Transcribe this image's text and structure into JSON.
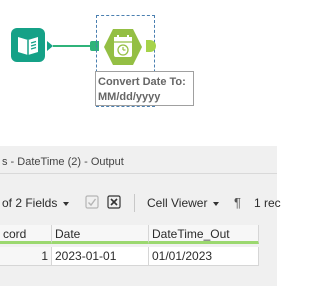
{
  "canvas": {
    "annotation": "Convert Date To:\nMM/dd/yyyy",
    "colors": {
      "input_tool": "#15a187",
      "connection": "#2fb37a",
      "datetime_tool": "#94bf44",
      "output_anchor": "#a6d34a"
    },
    "icons": {
      "input_tool": "book-icon",
      "datetime_tool": "calendar-clock-icon"
    }
  },
  "results": {
    "title": "s - DateTime (2) - Output",
    "toolbar": {
      "fields_label": "of 2 Fields",
      "cell_viewer_label": "Cell Viewer",
      "record_count_label": "1 rec"
    },
    "columns": [
      "cord",
      "Date",
      "DateTime_Out"
    ],
    "rows": [
      {
        "record": "1",
        "date": "2023-01-01",
        "datetime_out": "01/01/2023"
      }
    ]
  }
}
